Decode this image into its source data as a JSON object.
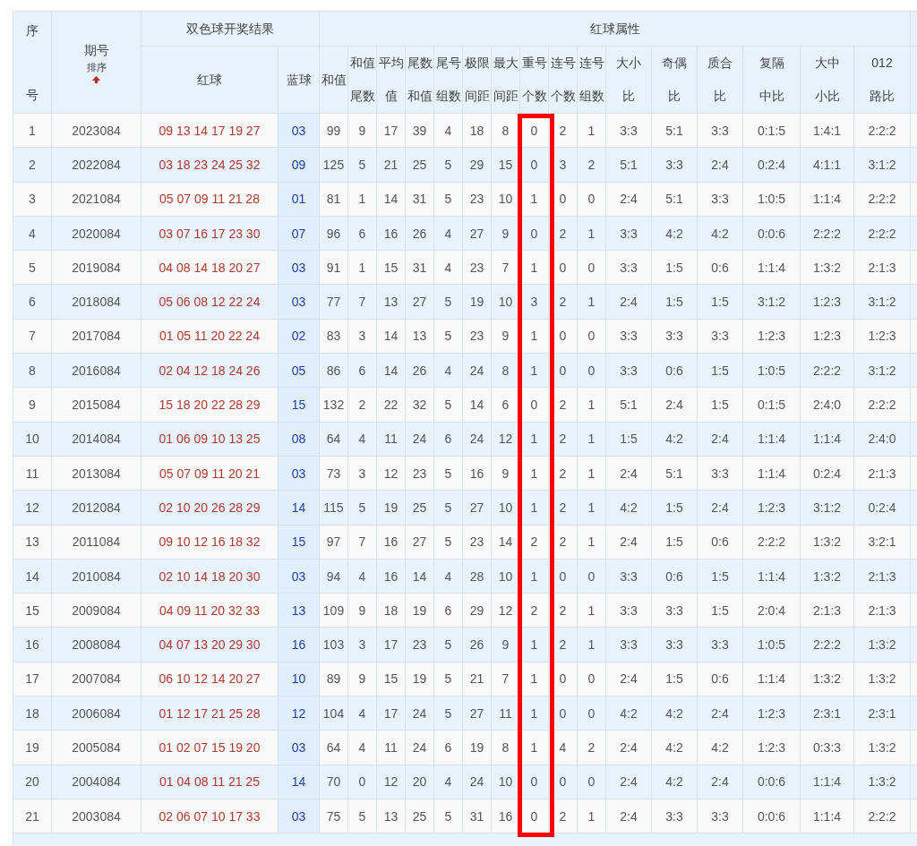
{
  "table": {
    "lead_columns": [
      {
        "lines": [
          "序",
          "号"
        ]
      },
      {
        "lines": [
          "期号"
        ],
        "sort": "排序"
      }
    ],
    "groups": [
      {
        "title": "双色球开奖结果",
        "columns": [
          {
            "lines": [
              "红球"
            ],
            "highlighted": false
          },
          {
            "lines": [
              "蓝球"
            ],
            "highlighted": false
          }
        ]
      },
      {
        "title": "红球属性",
        "columns": [
          {
            "lines": [
              "和值"
            ],
            "highlighted": false
          },
          {
            "lines": [
              "和值",
              "尾数"
            ],
            "highlighted": false
          },
          {
            "lines": [
              "平均",
              "值"
            ],
            "highlighted": false
          },
          {
            "lines": [
              "尾数",
              "和值"
            ],
            "highlighted": false
          },
          {
            "lines": [
              "尾号",
              "组数"
            ],
            "highlighted": false
          },
          {
            "lines": [
              "极限",
              "间距"
            ],
            "highlighted": false
          },
          {
            "lines": [
              "最大",
              "间距"
            ],
            "highlighted": false
          },
          {
            "lines": [
              "重号",
              "个数"
            ],
            "highlighted": true
          },
          {
            "lines": [
              "连号",
              "个数"
            ],
            "highlighted": false
          },
          {
            "lines": [
              "连号",
              "组数"
            ],
            "highlighted": false
          },
          {
            "lines": [
              "大小",
              "比"
            ],
            "highlighted": false
          },
          {
            "lines": [
              "奇偶",
              "比"
            ],
            "highlighted": false
          },
          {
            "lines": [
              "质合",
              "比"
            ],
            "highlighted": false
          },
          {
            "lines": [
              "复隔",
              "中比"
            ],
            "highlighted": false
          },
          {
            "lines": [
              "大中",
              "小比"
            ],
            "highlighted": false
          },
          {
            "lines": [
              "012",
              "路比"
            ],
            "highlighted": false
          }
        ]
      }
    ],
    "rows": [
      {
        "no": "1",
        "issue": "2023084",
        "red": "09 13 14 17 19 27",
        "blue": "03",
        "values": [
          "99",
          "9",
          "17",
          "39",
          "4",
          "18",
          "8",
          "0",
          "2",
          "1",
          "3:3",
          "5:1",
          "3:3",
          "0:1:5",
          "1:4:1",
          "2:2:2"
        ]
      },
      {
        "no": "2",
        "issue": "2022084",
        "red": "03 18 23 24 25 32",
        "blue": "09",
        "values": [
          "125",
          "5",
          "21",
          "25",
          "5",
          "29",
          "15",
          "0",
          "3",
          "2",
          "5:1",
          "3:3",
          "2:4",
          "0:2:4",
          "4:1:1",
          "3:1:2"
        ]
      },
      {
        "no": "3",
        "issue": "2021084",
        "red": "05 07 09 11 21 28",
        "blue": "01",
        "values": [
          "81",
          "1",
          "14",
          "31",
          "5",
          "23",
          "10",
          "1",
          "0",
          "0",
          "2:4",
          "5:1",
          "3:3",
          "1:0:5",
          "1:1:4",
          "2:2:2"
        ]
      },
      {
        "no": "4",
        "issue": "2020084",
        "red": "03 07 16 17 23 30",
        "blue": "07",
        "values": [
          "96",
          "6",
          "16",
          "26",
          "4",
          "27",
          "9",
          "0",
          "2",
          "1",
          "3:3",
          "4:2",
          "4:2",
          "0:0:6",
          "2:2:2",
          "2:2:2"
        ]
      },
      {
        "no": "5",
        "issue": "2019084",
        "red": "04 08 14 18 20 27",
        "blue": "03",
        "values": [
          "91",
          "1",
          "15",
          "31",
          "4",
          "23",
          "7",
          "1",
          "0",
          "0",
          "3:3",
          "1:5",
          "0:6",
          "1:1:4",
          "1:3:2",
          "2:1:3"
        ]
      },
      {
        "no": "6",
        "issue": "2018084",
        "red": "05 06 08 12 22 24",
        "blue": "03",
        "values": [
          "77",
          "7",
          "13",
          "27",
          "5",
          "19",
          "10",
          "3",
          "2",
          "1",
          "2:4",
          "1:5",
          "1:5",
          "3:1:2",
          "1:2:3",
          "3:1:2"
        ]
      },
      {
        "no": "7",
        "issue": "2017084",
        "red": "01 05 11 20 22 24",
        "blue": "02",
        "values": [
          "83",
          "3",
          "14",
          "13",
          "5",
          "23",
          "9",
          "1",
          "0",
          "0",
          "3:3",
          "3:3",
          "3:3",
          "1:2:3",
          "1:2:3",
          "1:2:3"
        ]
      },
      {
        "no": "8",
        "issue": "2016084",
        "red": "02 04 12 18 24 26",
        "blue": "05",
        "values": [
          "86",
          "6",
          "14",
          "26",
          "4",
          "24",
          "8",
          "1",
          "0",
          "0",
          "3:3",
          "0:6",
          "1:5",
          "1:0:5",
          "2:2:2",
          "3:1:2"
        ]
      },
      {
        "no": "9",
        "issue": "2015084",
        "red": "15 18 20 22 28 29",
        "blue": "15",
        "values": [
          "132",
          "2",
          "22",
          "32",
          "5",
          "14",
          "6",
          "0",
          "2",
          "1",
          "5:1",
          "2:4",
          "1:5",
          "0:1:5",
          "2:4:0",
          "2:2:2"
        ]
      },
      {
        "no": "10",
        "issue": "2014084",
        "red": "01 06 09 10 13 25",
        "blue": "08",
        "values": [
          "64",
          "4",
          "11",
          "24",
          "6",
          "24",
          "12",
          "1",
          "2",
          "1",
          "1:5",
          "4:2",
          "2:4",
          "1:1:4",
          "1:1:4",
          "2:4:0"
        ]
      },
      {
        "no": "11",
        "issue": "2013084",
        "red": "05 07 09 11 20 21",
        "blue": "03",
        "values": [
          "73",
          "3",
          "12",
          "23",
          "5",
          "16",
          "9",
          "1",
          "2",
          "1",
          "2:4",
          "5:1",
          "3:3",
          "1:1:4",
          "0:2:4",
          "2:1:3"
        ]
      },
      {
        "no": "12",
        "issue": "2012084",
        "red": "02 10 20 26 28 29",
        "blue": "14",
        "values": [
          "115",
          "5",
          "19",
          "25",
          "5",
          "27",
          "10",
          "1",
          "2",
          "1",
          "4:2",
          "1:5",
          "2:4",
          "1:2:3",
          "3:1:2",
          "0:2:4"
        ]
      },
      {
        "no": "13",
        "issue": "2011084",
        "red": "09 10 12 16 18 32",
        "blue": "15",
        "values": [
          "97",
          "7",
          "16",
          "27",
          "5",
          "23",
          "14",
          "2",
          "2",
          "1",
          "2:4",
          "1:5",
          "0:6",
          "2:2:2",
          "1:3:2",
          "3:2:1"
        ]
      },
      {
        "no": "14",
        "issue": "2010084",
        "red": "02 10 14 18 20 30",
        "blue": "03",
        "values": [
          "94",
          "4",
          "16",
          "14",
          "4",
          "28",
          "10",
          "1",
          "0",
          "0",
          "3:3",
          "0:6",
          "1:5",
          "1:1:4",
          "1:3:2",
          "2:1:3"
        ]
      },
      {
        "no": "15",
        "issue": "2009084",
        "red": "04 09 11 20 32 33",
        "blue": "13",
        "values": [
          "109",
          "9",
          "18",
          "19",
          "6",
          "29",
          "12",
          "2",
          "2",
          "1",
          "3:3",
          "3:3",
          "1:5",
          "2:0:4",
          "2:1:3",
          "2:1:3"
        ]
      },
      {
        "no": "16",
        "issue": "2008084",
        "red": "04 07 13 20 29 30",
        "blue": "16",
        "values": [
          "103",
          "3",
          "17",
          "23",
          "5",
          "26",
          "9",
          "1",
          "2",
          "1",
          "3:3",
          "3:3",
          "3:3",
          "1:0:5",
          "2:2:2",
          "1:3:2"
        ]
      },
      {
        "no": "17",
        "issue": "2007084",
        "red": "06 10 12 14 20 27",
        "blue": "10",
        "values": [
          "89",
          "9",
          "15",
          "19",
          "5",
          "21",
          "7",
          "1",
          "0",
          "0",
          "2:4",
          "1:5",
          "0:6",
          "1:1:4",
          "1:3:2",
          "1:3:2"
        ]
      },
      {
        "no": "18",
        "issue": "2006084",
        "red": "01 12 17 21 25 28",
        "blue": "12",
        "values": [
          "104",
          "4",
          "17",
          "24",
          "5",
          "27",
          "11",
          "1",
          "0",
          "0",
          "4:2",
          "4:2",
          "2:4",
          "1:2:3",
          "2:3:1",
          "2:3:1"
        ]
      },
      {
        "no": "19",
        "issue": "2005084",
        "red": "01 02 07 15 19 20",
        "blue": "03",
        "values": [
          "64",
          "4",
          "11",
          "24",
          "6",
          "19",
          "8",
          "1",
          "4",
          "2",
          "2:4",
          "4:2",
          "4:2",
          "1:2:3",
          "0:3:3",
          "1:3:2"
        ]
      },
      {
        "no": "20",
        "issue": "2004084",
        "red": "01 04 08 11 21 25",
        "blue": "14",
        "values": [
          "70",
          "0",
          "12",
          "20",
          "4",
          "24",
          "10",
          "0",
          "0",
          "0",
          "2:4",
          "4:2",
          "2:4",
          "0:0:6",
          "1:1:4",
          "1:3:2"
        ]
      },
      {
        "no": "21",
        "issue": "2003084",
        "red": "02 06 07 10 17 33",
        "blue": "03",
        "values": [
          "75",
          "5",
          "13",
          "25",
          "5",
          "31",
          "16",
          "0",
          "2",
          "1",
          "2:4",
          "3:3",
          "3:3",
          "0:0:6",
          "1:1:4",
          "2:2:2"
        ]
      }
    ]
  }
}
